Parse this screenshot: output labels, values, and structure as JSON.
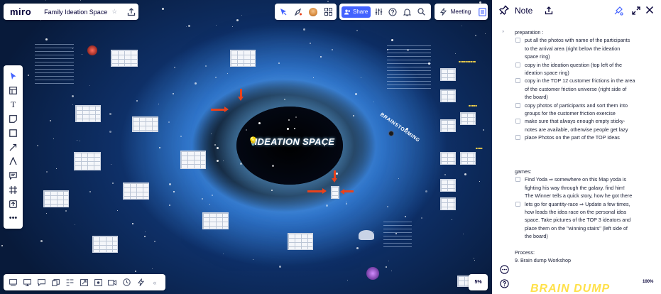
{
  "app": {
    "logo": "miro",
    "board_title": "Family Ideation Space"
  },
  "toolbar": {
    "share_label": "Share",
    "meeting_label": "Meeting"
  },
  "left_tools": [
    "select-icon",
    "table-icon",
    "text-icon",
    "sticky-note-icon",
    "shape-icon",
    "connector-icon",
    "pen-icon",
    "comment-icon",
    "frame-icon",
    "upload-icon",
    "more-icon"
  ],
  "bottom_tools": [
    "frames-icon",
    "presentation-icon",
    "comments-icon",
    "cards-icon",
    "kanban-icon",
    "link-icon",
    "screen-record-icon",
    "video-icon",
    "timer-icon",
    "reactions-icon",
    "collapse-icon"
  ],
  "board": {
    "zoom": "5%",
    "center_title": "IDEATION SPACE",
    "side_label": "BRAINSTORMING"
  },
  "note": {
    "title": "Note",
    "preparation_heading": "preparation :",
    "preparation_tasks": [
      [
        "put all the photos with name of the participants",
        "to the arrival area (right below the ideation",
        "space ring)"
      ],
      [
        "copy in the ideation question (top left of the",
        "ideation space ring)"
      ],
      [
        "copy in the TOP 12 customer frictions in the area",
        "of the customer friction universe (right side of",
        "the board)"
      ],
      [
        "copy photos of participants and sort them into",
        "groups for the customer friction exercise"
      ],
      [
        "make sure that always enough empty sticky-",
        "notes are available, otherwise people get lazy"
      ],
      [
        "place Photos on the part of the TOP Ideas"
      ]
    ],
    "games_heading": "games:",
    "games_tasks": [
      [
        "Find Yoda ⇒ somewhere on this Map yoda is",
        "fighting his way through the galaxy. find him!",
        "The Winner tells a quick story, how he got there"
      ],
      [
        "lets go for quantity-race ⇒ Update a few times,",
        "how leads the idea race on the personal idea",
        "space. Take pictures of the TOP 3 ideators and",
        "place them on the \"winning stairs\" (left side of",
        "the board)"
      ]
    ],
    "process_heading": "Process:",
    "process_item": "9. Brain dump Workshop",
    "zoom": "100%",
    "preview_text": "BRAIN DUMP"
  },
  "colors": {
    "accent": "#4262ff",
    "arrow": "#e8421c",
    "preview": "#ffe14a"
  }
}
